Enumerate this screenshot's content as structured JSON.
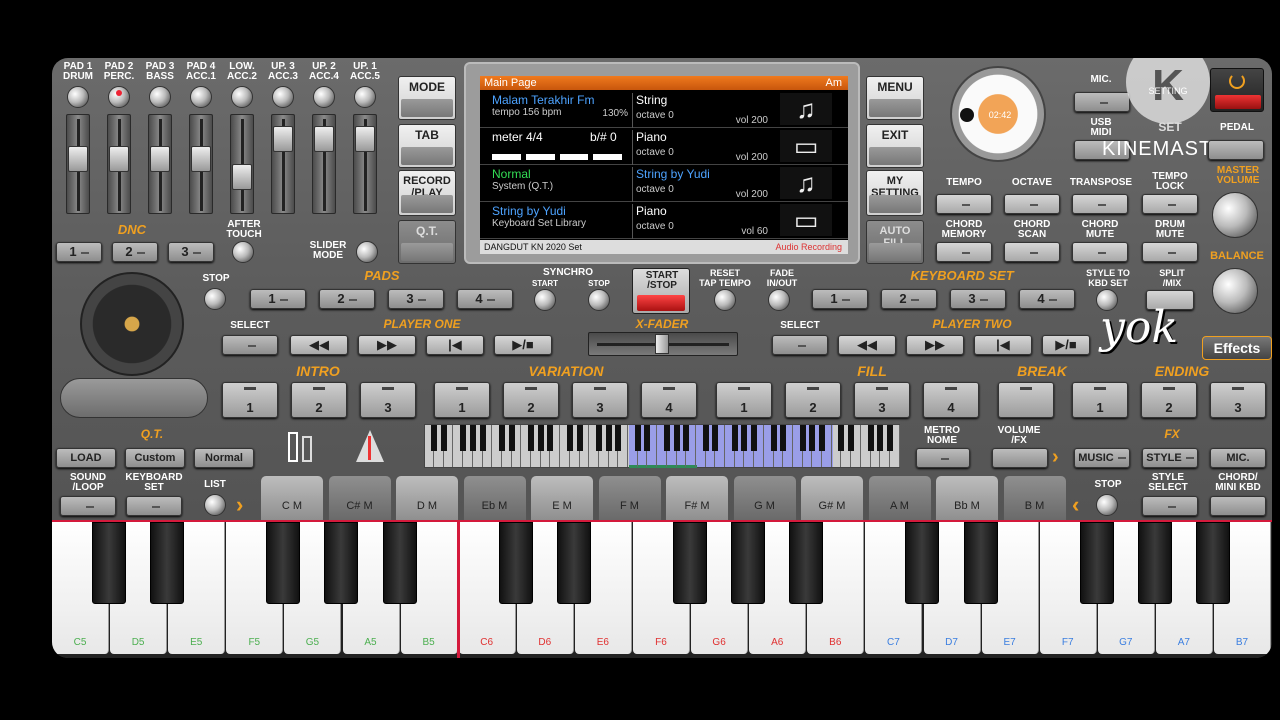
{
  "mixer": {
    "channels": [
      {
        "label": "PAD 1\nDRUM",
        "fader": 0.55
      },
      {
        "label": "PAD 2\nPERC.",
        "fader": 0.55
      },
      {
        "label": "PAD 3\nBASS",
        "fader": 0.55
      },
      {
        "label": "PAD 4\nACC.1",
        "fader": 0.55
      },
      {
        "label": "LOW.\nACC.2",
        "fader": 0.3
      },
      {
        "label": "UP. 3\nACC.3",
        "fader": 0.85
      },
      {
        "label": "UP. 2\nACC.4",
        "fader": 0.85
      },
      {
        "label": "UP. 1\nACC.5",
        "fader": 0.85
      }
    ],
    "dnc_label": "DNC",
    "dnc_buttons": [
      "1",
      "2",
      "3"
    ],
    "after_touch": "AFTER\nTOUCH",
    "slider_mode": "SLIDER\nMODE"
  },
  "left_buttons": {
    "mode": "MODE",
    "tab": "TAB",
    "record": "RECORD\n/PLAY",
    "qt": "Q.T."
  },
  "right_buttons": {
    "menu": "MENU",
    "exit": "EXIT",
    "my_setting": "MY\nSETTING",
    "auto_fill": "AUTO\nFILL"
  },
  "screen": {
    "header": "Main Page",
    "header_right": "Am",
    "rows": [
      {
        "left": "Malam Terakhir Fm",
        "left_sub": "tempo 156 bpm",
        "left_sub2": "130%",
        "right": "String",
        "right_sub": "octave 0",
        "vol": "vol 200"
      },
      {
        "left": "meter 4/4",
        "left_sub": "b/# 0",
        "right": "Piano",
        "right_sub": "octave 0",
        "vol": "vol 200"
      },
      {
        "left": "Normal",
        "left_sub": "System (Q.T.)",
        "right": "String by Yudi",
        "right_sub": "octave 0",
        "vol": "vol 200"
      },
      {
        "left": "String by Yudi",
        "left_sub": "Keyboard Set Library",
        "right": "Piano",
        "right_sub": "octave 0",
        "vol": "vol 60"
      }
    ],
    "footer": "DANGDUT KN 2020 Set",
    "footer_right": "Audio Recording"
  },
  "top_right": {
    "mic": "MIC.",
    "usb_midi": "USB\nMIDI",
    "set": "SET",
    "pedal": "PEDAL",
    "master_volume": "MASTER\nVOLUME",
    "balance": "BALANCE",
    "tempo": "TEMPO",
    "octave": "OCTAVE",
    "transpose": "TRANSPOSE",
    "tempo_lock": "TEMPO\nLOCK",
    "chord_memory": "CHORD\nMEMORY",
    "chord_scan": "CHORD\nSCAN",
    "chord_mute": "CHORD\nMUTE",
    "drum_mute": "DRUM\nMUTE",
    "dial_text": "02:42",
    "setting_text": "SETTING"
  },
  "watermark": "KINEMASTER",
  "pads": {
    "stop": "STOP",
    "label": "PADS",
    "buttons": [
      "1",
      "2",
      "3",
      "4"
    ]
  },
  "synchro": {
    "label": "SYNCHRO",
    "start": "START",
    "stop": "STOP"
  },
  "start_stop": "START\n/STOP",
  "reset": "RESET\nTAP TEMPO",
  "fade": "FADE\nIN/OUT",
  "keyboard_set": {
    "label": "KEYBOARD SET",
    "buttons": [
      "1",
      "2",
      "3",
      "4"
    ],
    "style_to_kbd": "STYLE TO\nKBD SET",
    "split": "SPLIT\n/MIX"
  },
  "player_one": {
    "select": "SELECT",
    "label": "PLAYER ONE"
  },
  "xfader": "X-FADER",
  "player_two": {
    "select": "SELECT",
    "label": "PLAYER TWO"
  },
  "overlay_text": "yok",
  "effects": "Effects",
  "sections": {
    "intro": {
      "label": "INTRO",
      "buttons": [
        "1",
        "2",
        "3"
      ]
    },
    "variation": {
      "label": "VARIATION",
      "buttons": [
        "1",
        "2",
        "3",
        "4"
      ]
    },
    "fill": {
      "label": "FILL",
      "buttons": [
        "1",
        "2",
        "3",
        "4"
      ]
    },
    "break": {
      "label": "BREAK"
    },
    "ending": {
      "label": "ENDING",
      "buttons": [
        "1",
        "2",
        "3"
      ]
    }
  },
  "qt": {
    "label": "Q.T.",
    "buttons": [
      "LOAD",
      "Custom",
      "Normal"
    ]
  },
  "metronome": "METRO\nNOME",
  "volume_fx": "VOLUME\n/FX",
  "fx": {
    "label": "FX",
    "buttons": [
      "MUSIC",
      "STYLE",
      "MIC."
    ]
  },
  "bottom_left": {
    "sound_loop": "SOUND\n/LOOP",
    "keyboard_set": "KEYBOARD\nSET",
    "list": "LIST"
  },
  "bottom_right": {
    "stop": "STOP",
    "style_select": "STYLE\nSELECT",
    "chord_mini": "CHORD/\nMINI KBD"
  },
  "chords": [
    "C M",
    "C# M",
    "D M",
    "Eb M",
    "E M",
    "F M",
    "F# M",
    "G M",
    "G# M",
    "A M",
    "Bb M",
    "B M"
  ],
  "keys": [
    {
      "n": "C5",
      "c": "#4caf50"
    },
    {
      "n": "D5",
      "c": "#4caf50"
    },
    {
      "n": "E5",
      "c": "#4caf50"
    },
    {
      "n": "F5",
      "c": "#4caf50"
    },
    {
      "n": "G5",
      "c": "#4caf50"
    },
    {
      "n": "A5",
      "c": "#4caf50"
    },
    {
      "n": "B5",
      "c": "#4caf50"
    },
    {
      "n": "C6",
      "c": "#e03030"
    },
    {
      "n": "D6",
      "c": "#e03030"
    },
    {
      "n": "E6",
      "c": "#e03030"
    },
    {
      "n": "F6",
      "c": "#e03030"
    },
    {
      "n": "G6",
      "c": "#e03030"
    },
    {
      "n": "A6",
      "c": "#e03030"
    },
    {
      "n": "B6",
      "c": "#e03030"
    },
    {
      "n": "C7",
      "c": "#3a7ee0"
    },
    {
      "n": "D7",
      "c": "#3a7ee0"
    },
    {
      "n": "E7",
      "c": "#3a7ee0"
    },
    {
      "n": "F7",
      "c": "#3a7ee0"
    },
    {
      "n": "G7",
      "c": "#3a7ee0"
    },
    {
      "n": "A7",
      "c": "#3a7ee0"
    },
    {
      "n": "B7",
      "c": "#3a7ee0"
    }
  ]
}
